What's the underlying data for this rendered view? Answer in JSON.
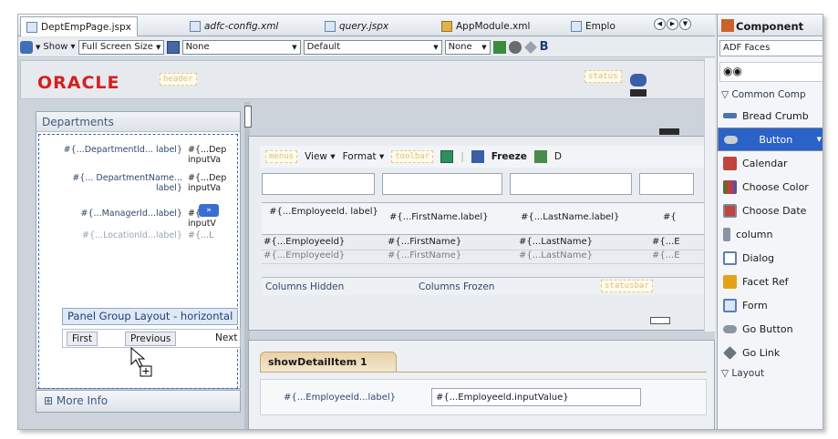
{
  "editor_tabs": [
    {
      "label": "DeptEmpPage.jspx",
      "italic": false
    },
    {
      "label": "adfc-config.xml",
      "italic": true
    },
    {
      "label": "query.jspx",
      "italic": true
    },
    {
      "label": "AppModule.xml",
      "italic": false
    },
    {
      "label": "Emplo",
      "italic": false
    }
  ],
  "toolbar": {
    "show_label": "Show",
    "screen_size": "Full Screen Size",
    "style_select": "None",
    "skin_select": "Default",
    "facet_select": "None",
    "bold": "B"
  },
  "designer": {
    "header": {
      "logo": "ORACLE",
      "header_facet": "header",
      "status_facet": "status"
    },
    "departments": {
      "title": "Departments",
      "rows": [
        {
          "label": "#{...Departmentld... label}",
          "value": "#{...Dep inputVa"
        },
        {
          "label": "#{... DepartmentName... label}",
          "value": "#{...Dep inputVa"
        },
        {
          "label": "#{...Managerld...label}",
          "value": "#{... inputV"
        },
        {
          "label": "#{...Locationld...label}",
          "value": "#{...L"
        }
      ],
      "tooltip": "Panel Group Layout - horizontal",
      "nav": {
        "first": "First",
        "previous": "Previous",
        "next": "Next"
      },
      "more_info": "More Info"
    },
    "table": {
      "menus_facet": "menus",
      "view_menu": "View",
      "format_menu": "Format",
      "toolbar_facet": "toolbar",
      "freeze": "Freeze",
      "detach": "D",
      "headers": [
        "#{...Employeeld. label}",
        "#{...FirstName.label}",
        "#{...LastName.label}",
        "#{"
      ],
      "rows": [
        [
          "#{...Employeeld}",
          "#{...FirstName}",
          "#{...LastName}",
          "#{...E"
        ],
        [
          "#{...Employeeld}",
          "#{...FirstName}",
          "#{...LastName}",
          "#{...E"
        ]
      ],
      "columns_hidden": "Columns Hidden",
      "columns_frozen": "Columns Frozen",
      "statusbar_facet": "statusbar"
    },
    "detail": {
      "tab": "showDetailItem 1",
      "label": "#{...Employeeld...label}",
      "value": "#{...Employeeld.inputValue}"
    }
  },
  "palette": {
    "title": "Component",
    "library": "ADF Faces",
    "section": "Common Comp",
    "items": [
      {
        "label": "Bread Crumb",
        "icon": "breadcrumb-icon",
        "color": "#4a74b0"
      },
      {
        "label": "Button",
        "icon": "button-icon",
        "color": "#9aa3ad"
      },
      {
        "label": "Calendar",
        "icon": "calendar-icon",
        "color": "#c0453e"
      },
      {
        "label": "Choose Color",
        "icon": "color-grid-icon",
        "color": "#3a7a2e"
      },
      {
        "label": "Choose Date",
        "icon": "date-icon",
        "color": "#c0453e"
      },
      {
        "label": "column",
        "icon": "column-icon",
        "color": "#8a95a3"
      },
      {
        "label": "Dialog",
        "icon": "dialog-icon",
        "color": "#5b7fb0"
      },
      {
        "label": "Facet Ref",
        "icon": "facet-icon",
        "color": "#e3a21a"
      },
      {
        "label": "Form",
        "icon": "form-icon",
        "color": "#5b7fb0"
      },
      {
        "label": "Go Button",
        "icon": "go-button-icon",
        "color": "#8a95a3"
      },
      {
        "label": "Go Link",
        "icon": "link-icon",
        "color": "#6a7482"
      }
    ],
    "layout_section": "Layout"
  }
}
